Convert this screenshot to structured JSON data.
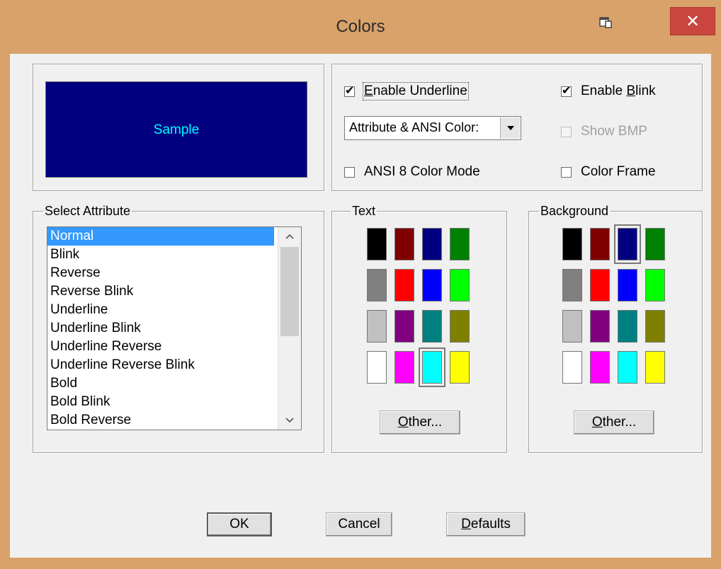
{
  "window": {
    "title": "Colors",
    "close_label": "✕"
  },
  "sample": {
    "text": "Sample"
  },
  "options": {
    "enable_underline": {
      "pre": "",
      "mn": "E",
      "post": "nable Underline",
      "checked": true
    },
    "enable_blink": {
      "pre": "Enable ",
      "mn": "B",
      "post": "link",
      "checked": true
    },
    "color_mode_select": {
      "value": "Attribute & ANSI Color:"
    },
    "show_bmp": {
      "label": "Show BMP",
      "checked": false,
      "disabled": true
    },
    "ansi8": {
      "label": "ANSI 8 Color Mode",
      "checked": false
    },
    "color_frame": {
      "label": "Color Frame",
      "checked": false
    }
  },
  "select_attribute": {
    "label": "Select Attribute",
    "items": [
      "Normal",
      "Blink",
      "Reverse",
      "Reverse Blink",
      "Underline",
      "Underline Blink",
      "Underline Reverse",
      "Underline Reverse Blink",
      "Bold",
      "Bold Blink",
      "Bold Reverse"
    ],
    "selected_index": 0
  },
  "text_group": {
    "label": "Text",
    "selected_color": "#00ffff"
  },
  "background_group": {
    "label": "Background",
    "selected_color": "#000080"
  },
  "palette": [
    "#000000",
    "#800000",
    "#000080",
    "#008000",
    "#808080",
    "#ff0000",
    "#0000ff",
    "#00ff00",
    "#c0c0c0",
    "#800080",
    "#008080",
    "#808000",
    "#ffffff",
    "#ff00ff",
    "#00ffff",
    "#ffff00"
  ],
  "buttons": {
    "other": {
      "mn": "O",
      "post": "ther..."
    },
    "ok": "OK",
    "cancel": "Cancel",
    "defaults": {
      "mn": "D",
      "post": "efaults"
    }
  }
}
